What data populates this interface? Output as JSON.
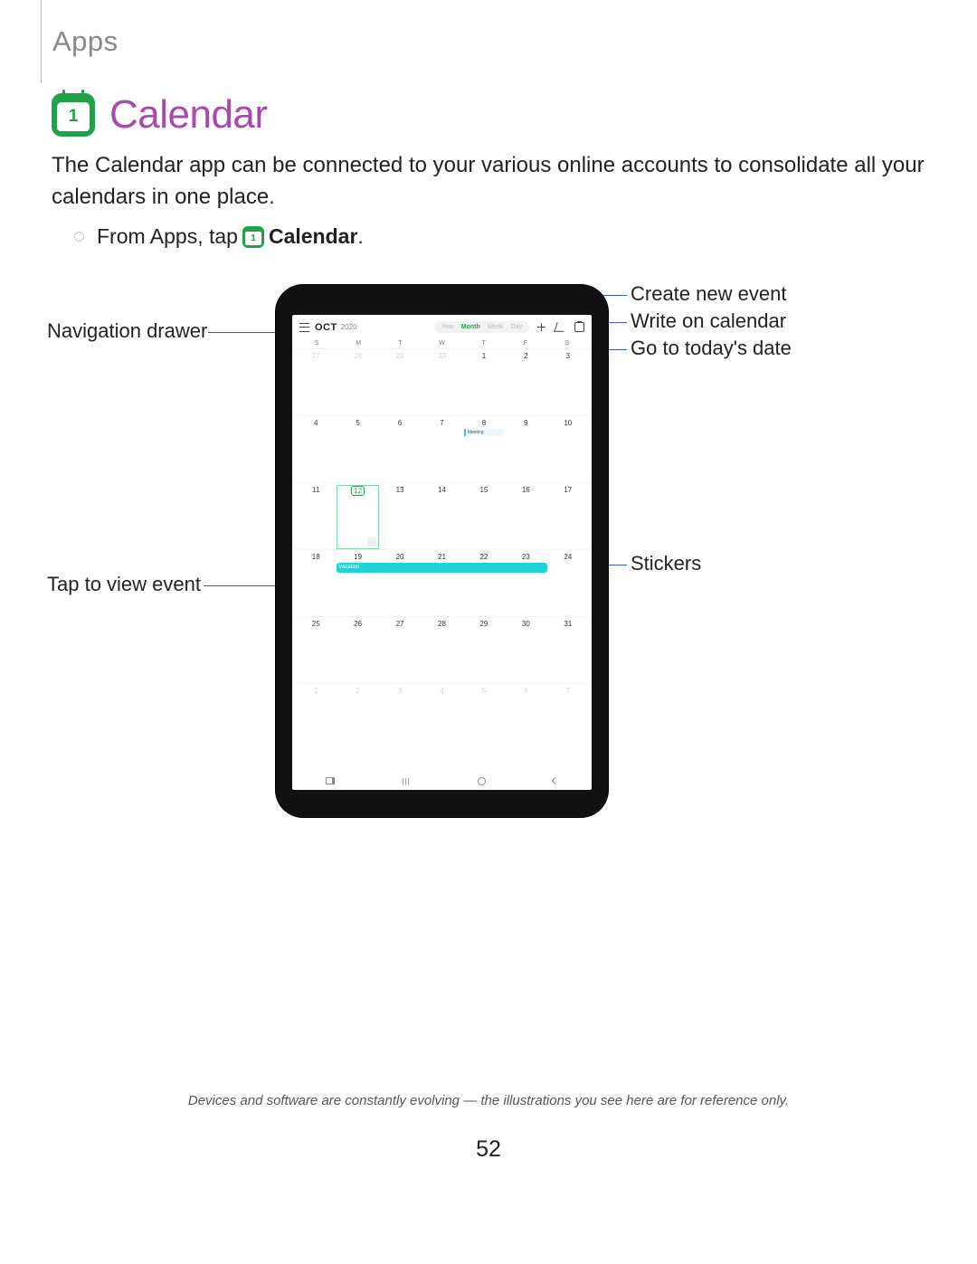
{
  "section": "Apps",
  "heading": "Calendar",
  "icon_num": "1",
  "intro": "The Calendar app can be connected to your various online accounts to consolidate all your calendars in one place.",
  "step_prefix": "From Apps, tap ",
  "step_bold": "Calendar",
  "step_suffix": ".",
  "callouts": {
    "nav_drawer": "Navigation drawer",
    "create_event": "Create new event",
    "write_cal": "Write on calendar",
    "go_today": "Go to today's date",
    "stickers": "Stickers",
    "tap_view": "Tap to view event"
  },
  "screen": {
    "month": "OCT",
    "year": "2020",
    "views": [
      "Year",
      "Month",
      "Week",
      "Day"
    ],
    "active_view": "Month",
    "day_headers": [
      "S",
      "M",
      "T",
      "W",
      "T",
      "F",
      "S"
    ],
    "meeting_label": "Meeting",
    "vacation_label": "Vacation",
    "nav_menu_sym": "|||",
    "rows": [
      [
        "27",
        "28",
        "29",
        "30",
        "1",
        "2",
        "3"
      ],
      [
        "4",
        "5",
        "6",
        "7",
        "8",
        "9",
        "10"
      ],
      [
        "11",
        "12",
        "13",
        "14",
        "15",
        "16",
        "17"
      ],
      [
        "18",
        "19",
        "20",
        "21",
        "22",
        "23",
        "24"
      ],
      [
        "25",
        "26",
        "27",
        "28",
        "29",
        "30",
        "31"
      ],
      [
        "1",
        "2",
        "3",
        "4",
        "5",
        "6",
        "7"
      ]
    ]
  },
  "footer": "Devices and software are constantly evolving — the illustrations you see here are for reference only.",
  "page_number": "52"
}
